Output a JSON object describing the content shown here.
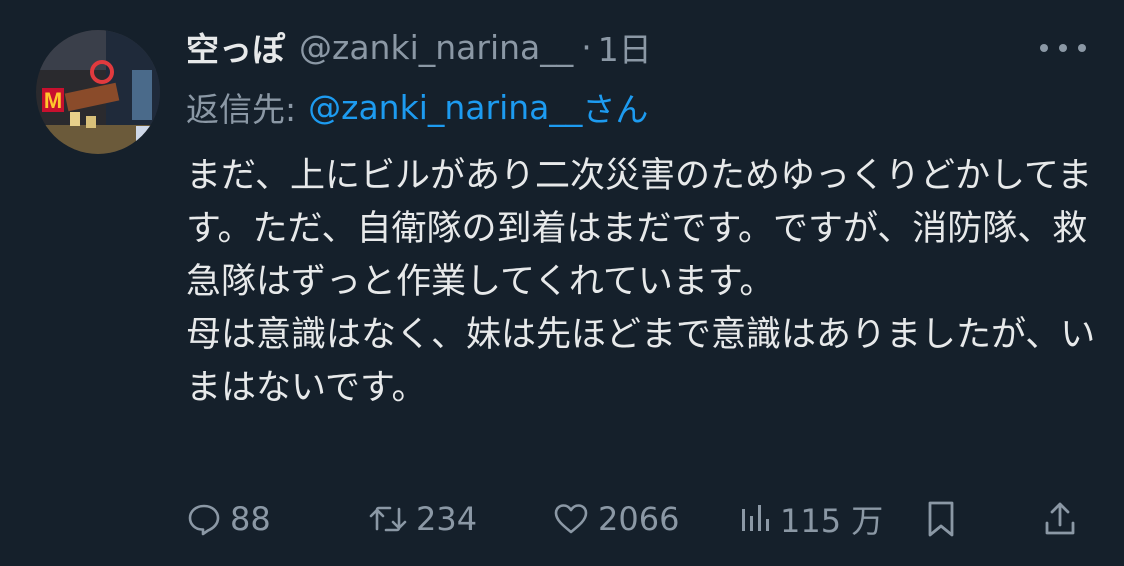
{
  "tweet": {
    "display_name": "空っぽ",
    "handle": "@zanki_narina__",
    "separator": "·",
    "time": "1日",
    "reply_label": "返信先:",
    "reply_mention": "@zanki_narina__",
    "reply_suffix": "さん",
    "paragraphs": [
      "まだ、上にビルがあり二次災害のためゆっくりどかしてます。ただ、自衛隊の到着はまだです。ですが、消防隊、救急隊はずっと作業してくれています。",
      "母は意識はなく、妹は先ほどまで意識はありましたが、いまはないです。"
    ]
  },
  "actions": {
    "replies": "88",
    "reposts": "234",
    "likes": "2066",
    "views": "115 万"
  },
  "icons": {
    "more": "more-horizontal-icon",
    "reply": "comment-icon",
    "repost": "repost-icon",
    "like": "heart-icon",
    "views": "analytics-icon",
    "bookmark": "bookmark-icon",
    "share": "share-icon"
  },
  "colors": {
    "background": "#15202b",
    "text": "#e7e9ea",
    "muted": "#8b98a5",
    "link": "#1d9bf0"
  }
}
